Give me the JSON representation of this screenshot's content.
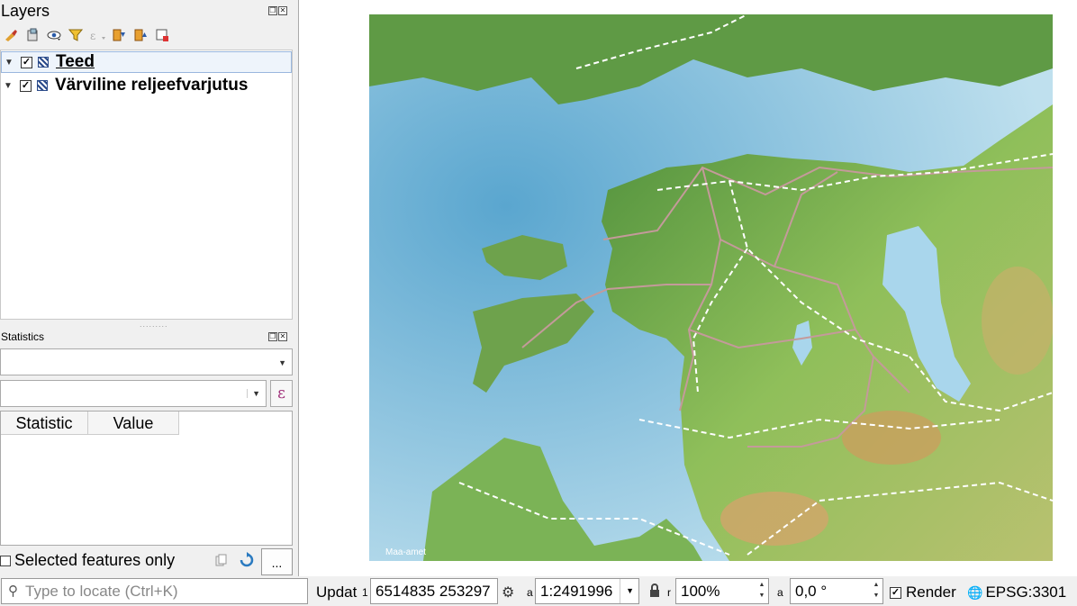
{
  "layers_panel": {
    "title": "Layers",
    "layers": [
      {
        "name": "Teed",
        "checked": true,
        "selected": true
      },
      {
        "name": "Värviline reljeefvarjutus",
        "checked": true,
        "selected": false
      }
    ]
  },
  "statistics_panel": {
    "title": "Statistics",
    "layer_combo_value": "",
    "field_combo_value": "",
    "table_headers": [
      "Statistic",
      "Value"
    ],
    "selected_only_label": "Selected features only",
    "more_button_label": "..."
  },
  "map": {
    "attribution": "Maa-amet"
  },
  "statusbar": {
    "locator_placeholder": "Type to locate (Ctrl+K)",
    "update_label": "Updat",
    "coordinate_value": "6514835  253297",
    "scale_value": "1:2491996",
    "magnifier_value": "100%",
    "rotation_value": "0,0 °",
    "render_label": "Render",
    "crs_label": "EPSG:3301"
  },
  "colors": {
    "sea": "#8fc6e0",
    "land": "#7fb25a",
    "highlands": "#c9a46a",
    "roads": "#c49a9a",
    "railways": "#ffffff"
  }
}
